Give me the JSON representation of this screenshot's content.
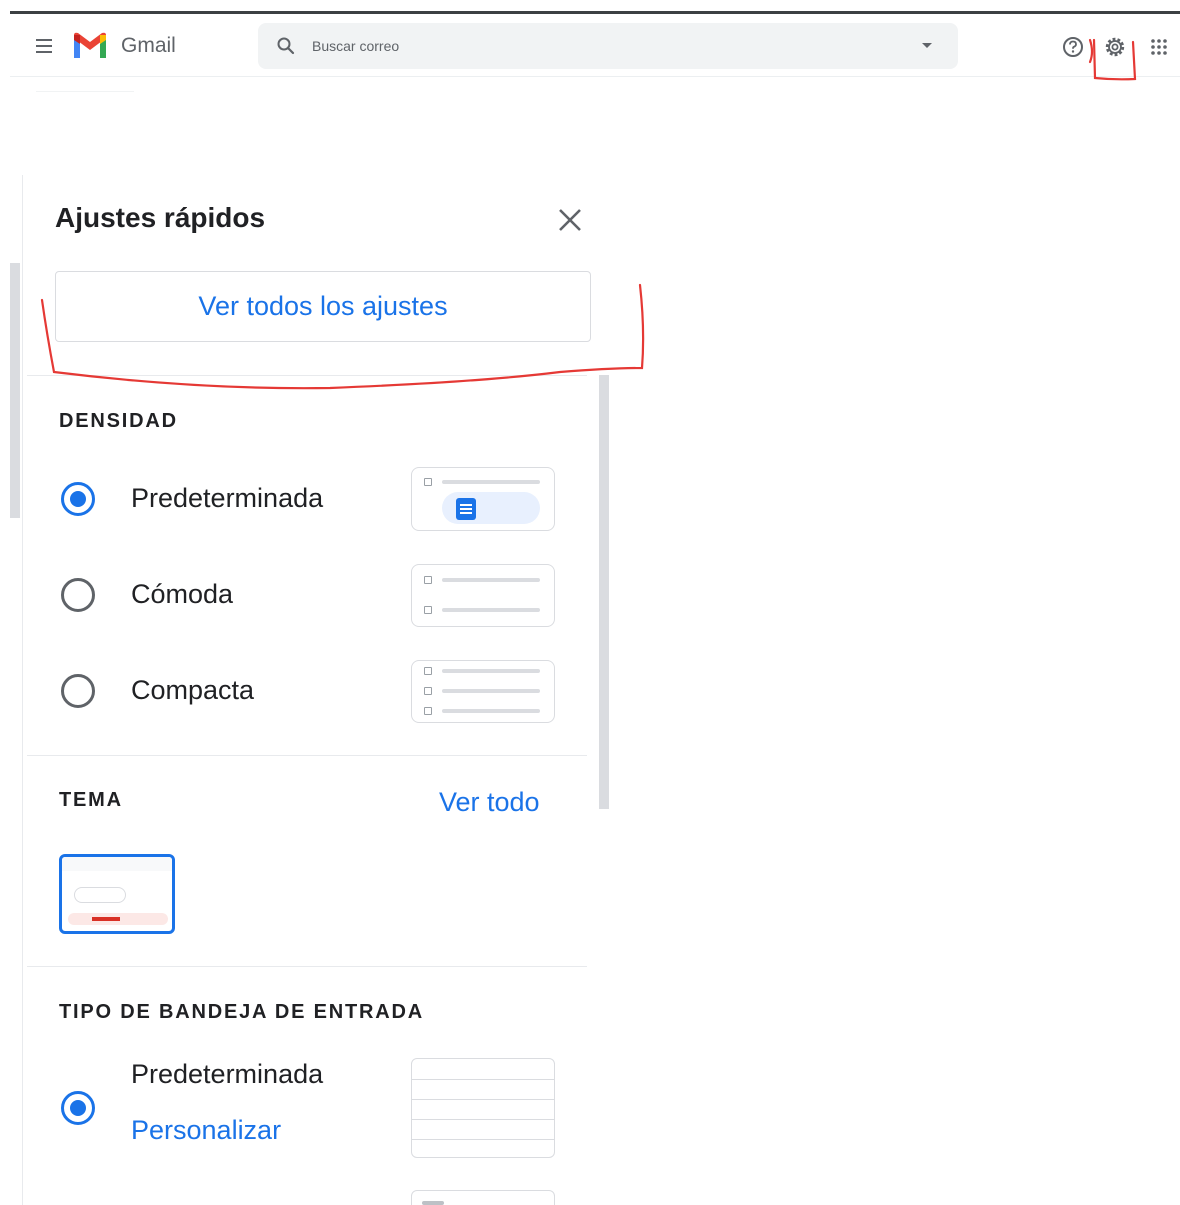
{
  "app": {
    "name": "Gmail"
  },
  "search": {
    "placeholder": "Buscar correo"
  },
  "quick_settings": {
    "title": "Ajustes rápidos",
    "see_all_settings_label": "Ver todos los ajustes",
    "density": {
      "title": "DENSIDAD",
      "options": [
        {
          "label": "Predeterminada",
          "selected": true
        },
        {
          "label": "Cómoda",
          "selected": false
        },
        {
          "label": "Compacta",
          "selected": false
        }
      ]
    },
    "theme": {
      "title": "TEMA",
      "see_all_label": "Ver todo"
    },
    "inbox_type": {
      "title": "TIPO DE BANDEJA DE ENTRADA",
      "options": [
        {
          "label": "Predeterminada",
          "selected": true,
          "customize_label": "Personalizar"
        }
      ]
    }
  },
  "icons": [
    "menu-icon",
    "gmail-logo",
    "search-icon",
    "dropdown-icon",
    "help-icon",
    "gear-icon",
    "apps-icon",
    "close-icon",
    "document-icon"
  ],
  "colors": {
    "accent": "#1a73e8",
    "annotation": "#e53935",
    "text": "#202124",
    "muted": "#5f6368"
  }
}
